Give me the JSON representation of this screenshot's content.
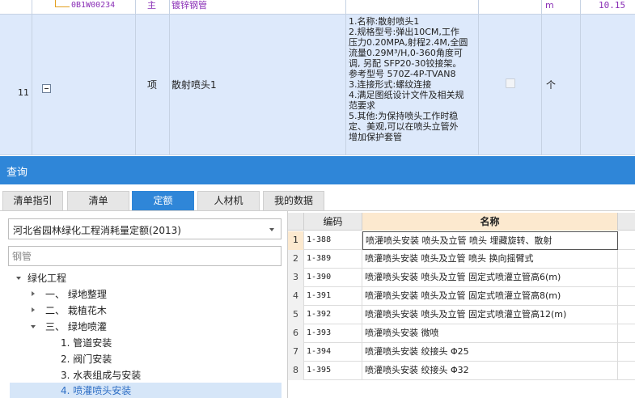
{
  "top_grid": {
    "row_prev": {
      "code": "0B1W00234",
      "type": "主",
      "name": "镀锌钢管",
      "unit": "m",
      "qty": "10.15"
    },
    "row_current": {
      "num": "11",
      "type": "项",
      "name": "散射喷头1",
      "features": [
        "1.名称:散射喷头1",
        "2.规格型号:弹出10CM,工作",
        "压力0.20MPA,射程2.4M,全圆",
        "流量0.29M³/H,0-360角度可",
        "调, 另配 SFP20-30铰接架。",
        "参考型号 570Z-4P-TVAN8",
        "3.连接形式:螺纹连接",
        "4.满足图纸设计文件及相关规",
        "范要求",
        "5.其他:为保持喷头工作时稳",
        "定、美观,可以在喷头立管外",
        "增加保护套管"
      ],
      "unit": "个"
    }
  },
  "query_panel": {
    "title": "查询",
    "tabs": [
      "清单指引",
      "清单",
      "定额",
      "人材机",
      "我的数据"
    ],
    "active_tab": "定额",
    "quota_library": "河北省园林绿化工程消耗量定额(2013)",
    "search_value": "钢管",
    "tree": {
      "root": "绿化工程",
      "items": [
        {
          "label": "一、 绿地整理",
          "state": "collapsed"
        },
        {
          "label": "二、 栽植花木",
          "state": "collapsed"
        },
        {
          "label": "三、 绿地喷灌",
          "state": "expanded"
        }
      ],
      "children": [
        "1. 管道安装",
        "2. 阀门安装",
        "3. 水表组成与安装",
        "4. 喷灌喷头安装"
      ],
      "selected": "4. 喷灌喷头安装"
    },
    "results": {
      "headers": {
        "code": "编码",
        "name": "名称"
      },
      "rows": [
        {
          "idx": "1",
          "code": "1-388",
          "name": "喷灌喷头安装 喷头及立管 喷头 埋藏旋转、散射"
        },
        {
          "idx": "2",
          "code": "1-389",
          "name": "喷灌喷头安装 喷头及立管 喷头 换向摇臂式"
        },
        {
          "idx": "3",
          "code": "1-390",
          "name": "喷灌喷头安装 喷头及立管 固定式喷灌立管高6(m)"
        },
        {
          "idx": "4",
          "code": "1-391",
          "name": "喷灌喷头安装 喷头及立管 固定式喷灌立管高8(m)"
        },
        {
          "idx": "5",
          "code": "1-392",
          "name": "喷灌喷头安装 喷头及立管 固定式喷灌立管高12(m)"
        },
        {
          "idx": "6",
          "code": "1-393",
          "name": "喷灌喷头安装 微喷"
        },
        {
          "idx": "7",
          "code": "1-394",
          "name": "喷灌喷头安装 绞接头 Φ25"
        },
        {
          "idx": "8",
          "code": "1-395",
          "name": "喷灌喷头安装 绞接头 Φ32"
        }
      ]
    }
  },
  "colors": {
    "accent": "#2f86d8",
    "row_highlight": "#dde9fb",
    "code_text": "#8a2fb6",
    "selected_tree": "#d6e6f8"
  }
}
